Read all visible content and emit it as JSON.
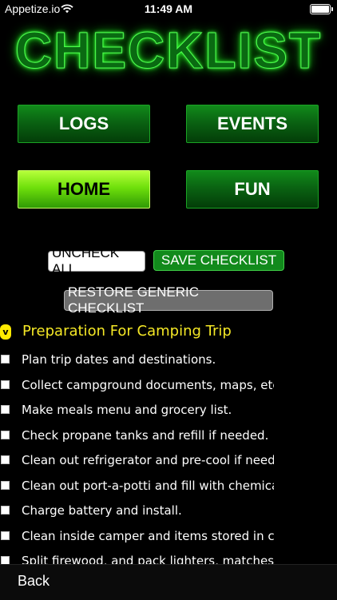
{
  "status_bar": {
    "carrier": "Appetize.io",
    "time": "11:49 AM"
  },
  "app_title": "CHECKLIST",
  "nav": {
    "logs": "LOGS",
    "events": "EVENTS",
    "home": "HOME",
    "fun": "FUN"
  },
  "actions": {
    "uncheck_all": "UNCHECK ALL",
    "save_checklist": "SAVE CHECKLIST",
    "restore_generic": "RESTORE GENERIC CHECKLIST"
  },
  "section": {
    "checkbox_mark": "v",
    "title": "Preparation For Camping Trip",
    "checked": true
  },
  "items": [
    "Plan trip dates and destinations.",
    "Collect campground documents, maps, etc.",
    "Make meals menu and  grocery list.",
    "Check propane tanks and refill if needed.",
    "Clean out refrigerator and pre-cool if needed.",
    "Clean out port-a-potti and fill with chemicals.",
    "Charge battery and install.",
    "Clean inside camper and items stored in camper.",
    "Split firewood, and pack lighters, matches, tinder."
  ],
  "bottom_bar": {
    "back_label": "Back"
  },
  "colors": {
    "background": "#000000",
    "nav_green": "#0a6312",
    "nav_active": "#6fe00b",
    "section_title": "#f5e826",
    "save_button": "#128a1c",
    "restore_button": "#6e6e6e"
  }
}
